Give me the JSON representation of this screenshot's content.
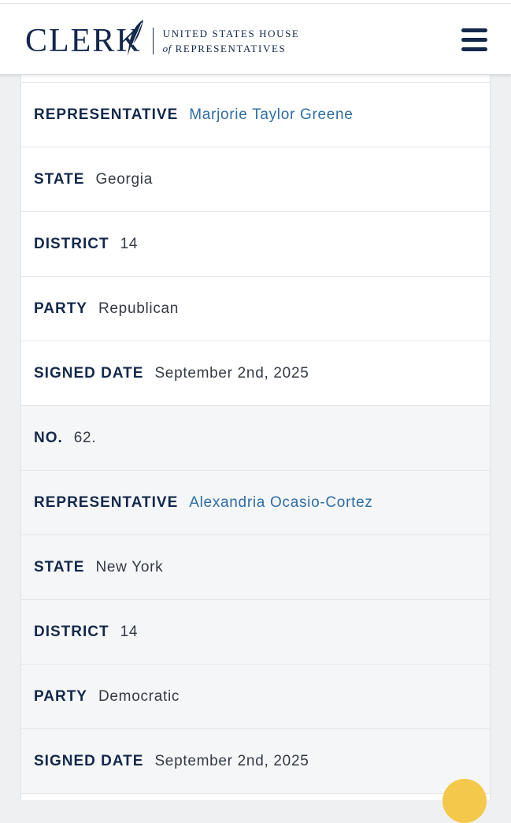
{
  "header": {
    "logo_word": "CLERK",
    "logo_line1": "UNITED STATES HOUSE",
    "logo_of": "of",
    "logo_line2": "REPRESENTATIVES",
    "menu_icon": "hamburger-menu-icon"
  },
  "records": [
    {
      "representative_label": "REPRESENTATIVE",
      "representative": "Marjorie Taylor Greene",
      "state_label": "STATE",
      "state": "Georgia",
      "district_label": "DISTRICT",
      "district": "14",
      "party_label": "PARTY",
      "party": "Republican",
      "signed_date_label": "SIGNED DATE",
      "signed_date": "September 2nd, 2025"
    },
    {
      "no_label": "NO.",
      "no": "62.",
      "representative_label": "REPRESENTATIVE",
      "representative": "Alexandria Ocasio-Cortez",
      "state_label": "STATE",
      "state": "New York",
      "district_label": "DISTRICT",
      "district": "14",
      "party_label": "PARTY",
      "party": "Democratic",
      "signed_date_label": "SIGNED DATE",
      "signed_date": "September 2nd, 2025"
    }
  ],
  "colors": {
    "brand_navy": "#13284b",
    "link_blue": "#2e6da4",
    "alt_row_bg": "#f5f6f8",
    "feedback_yellow": "#f4c84a"
  }
}
